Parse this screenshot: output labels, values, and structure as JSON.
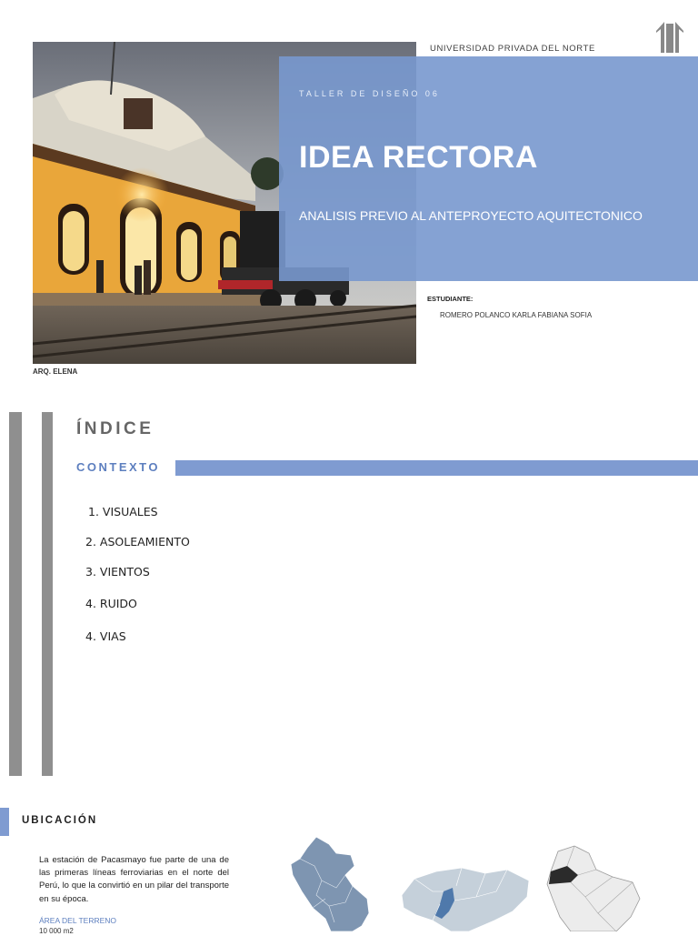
{
  "header": {
    "university": "UNIVERSIDAD PRIVADA DEL NORTE",
    "logo_icon": "upn-arrow-logo-icon"
  },
  "cover": {
    "photo_icon": "train-station-photo",
    "course": "TALLER DE DISEÑO 06",
    "title": "IDEA RECTORA",
    "subtitle": "ANALISIS PREVIO AL ANTEPROYECTO AQUITECTONICO",
    "panel_color": "#7898CE"
  },
  "student": {
    "label": "ESTUDIANTE:",
    "name": "ROMERO POLANCO  KARLA FABIANA SOFIA"
  },
  "teacher": {
    "label": "ARQ. ELENA"
  },
  "index": {
    "title": "ÍNDICE",
    "section_label": "CONTEXTO",
    "accent_color": "#7F9BD1",
    "items": [
      "1. VISUALES",
      "2. ASOLEAMIENTO",
      "3. VIENTOS",
      "4. RUIDO",
      "4. VIAS"
    ]
  },
  "location": {
    "title": "UBICACIÓN",
    "description": "La estación de Pacasmayo fue parte de una de las primeras líneas ferroviarias en el norte del Perú, lo que la convirtió en un pilar del transporte en su época.",
    "area_label": "ÁREA DEL TERRENO",
    "area_value": "10 000 m2",
    "maps": [
      "peru-map-icon",
      "region-map-icon",
      "district-map-icon"
    ]
  }
}
